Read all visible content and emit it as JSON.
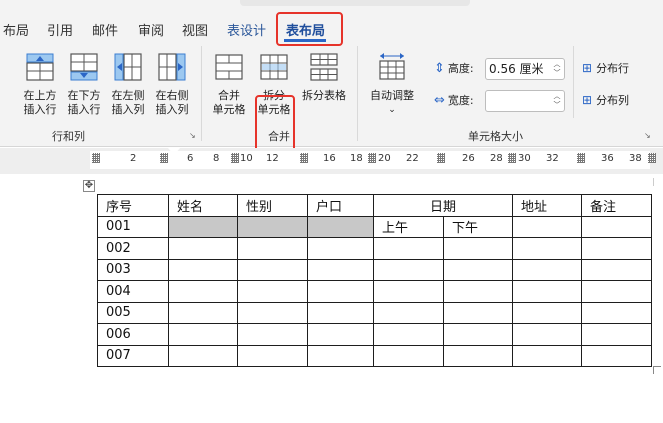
{
  "tabs": [
    {
      "label": "布局"
    },
    {
      "label": "引用"
    },
    {
      "label": "邮件"
    },
    {
      "label": "审阅"
    },
    {
      "label": "视图"
    },
    {
      "label": "表设计"
    },
    {
      "label": "表布局"
    }
  ],
  "groups": {
    "rows_cols": {
      "label": "行和列",
      "buttons": [
        {
          "line1": "在上方",
          "line2": "插入行"
        },
        {
          "line1": "在下方",
          "line2": "插入行"
        },
        {
          "line1": "在左侧",
          "line2": "插入列"
        },
        {
          "line1": "在右侧",
          "line2": "插入列"
        }
      ]
    },
    "merge": {
      "label": "合并",
      "buttons": [
        {
          "line1": "合并",
          "line2": "单元格"
        },
        {
          "line1": "拆分",
          "line2": "单元格"
        },
        {
          "line1": "拆分表格",
          "line2": ""
        }
      ]
    },
    "cell_size": {
      "label": "单元格大小",
      "autofit": {
        "label": "自动调整"
      },
      "height": {
        "label": "高度:",
        "value": "0.56 厘米"
      },
      "width": {
        "label": "宽度:",
        "value": ""
      },
      "distribute_rows": "分布行",
      "distribute_cols": "分布列"
    }
  },
  "ruler": {
    "numbers": [
      "2",
      "6",
      "8",
      "10",
      "12",
      "16",
      "18",
      "20",
      "22",
      "26",
      "28",
      "30",
      "32",
      "36",
      "38"
    ]
  },
  "table": {
    "headers": {
      "seq": "序号",
      "name": "姓名",
      "gender": "性别",
      "household": "户口",
      "date": "日期",
      "address": "地址",
      "remarks": "备注"
    },
    "sub_headers": {
      "am": "上午",
      "pm": "下午"
    },
    "rows": [
      "001",
      "002",
      "003",
      "004",
      "005",
      "006",
      "007"
    ]
  },
  "colors": {
    "highlight_box": "#e6332a",
    "active_tab": "#1f4e9c",
    "shaded_cell": "#c8c8c8"
  }
}
